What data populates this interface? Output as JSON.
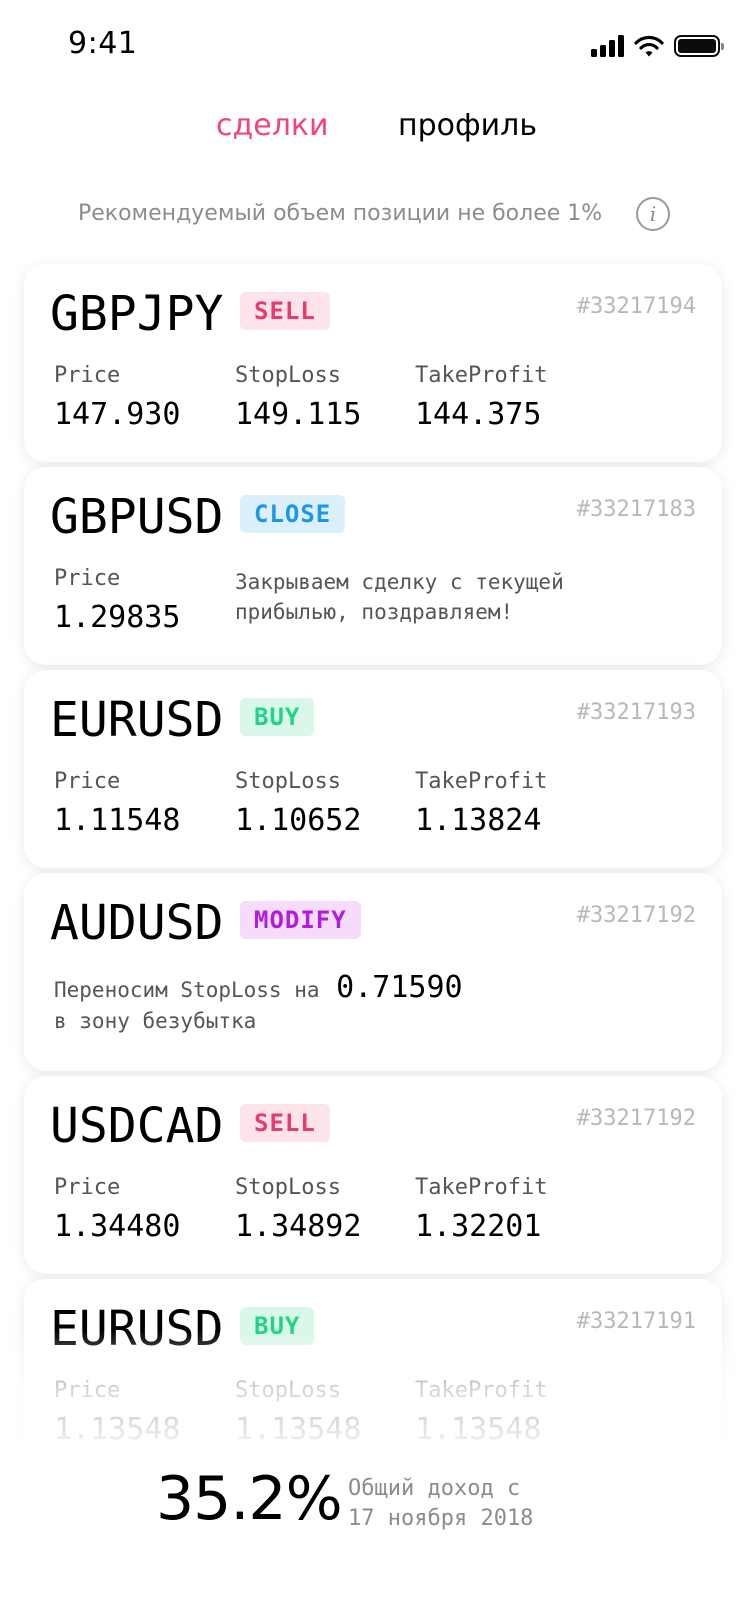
{
  "status_bar": {
    "time": "9:41"
  },
  "tabs": {
    "deals": "сделки",
    "profile": "профиль"
  },
  "hint": {
    "text": "Рекомендуемый объем позиции не более 1%",
    "icon": "info-icon"
  },
  "labels": {
    "price": "Price",
    "stoploss": "StopLoss",
    "takeprofit": "TakeProfit"
  },
  "colors": {
    "accent": "#f0467a",
    "sell": "#e83a6c",
    "close": "#1a98e6",
    "buy": "#21d587",
    "modify": "#b41cdc"
  },
  "deals": [
    {
      "pair": "GBPJPY",
      "action": "SELL",
      "id": "#33217194",
      "price": "147.930",
      "stoploss": "149.115",
      "takeprofit": "144.375"
    },
    {
      "pair": "GBPUSD",
      "action": "CLOSE",
      "id": "#33217183",
      "price": "1.29835",
      "message_line1": "Закрываем сделку с текущей",
      "message_line2": "прибылью, поздравляем!"
    },
    {
      "pair": "EURUSD",
      "action": "BUY",
      "id": "#33217193",
      "price": "1.11548",
      "stoploss": "1.10652",
      "takeprofit": "1.13824"
    },
    {
      "pair": "AUDUSD",
      "action": "MODIFY",
      "id": "#33217192",
      "message_prefix": "Переносим StopLoss на",
      "message_value": "0.71590",
      "message_line2": "в зону безубытка"
    },
    {
      "pair": "USDCAD",
      "action": "SELL",
      "id": "#33217192",
      "price": "1.34480",
      "stoploss": "1.34892",
      "takeprofit": "1.32201"
    },
    {
      "pair": "EURUSD",
      "action": "BUY",
      "id": "#33217191",
      "price": "1.13548",
      "stoploss": "1.13548",
      "takeprofit": "1.13548"
    }
  ],
  "footer": {
    "total": "35.2%",
    "caption_line1": "Общий доход с",
    "caption_line2": "17 ноября 2018"
  }
}
